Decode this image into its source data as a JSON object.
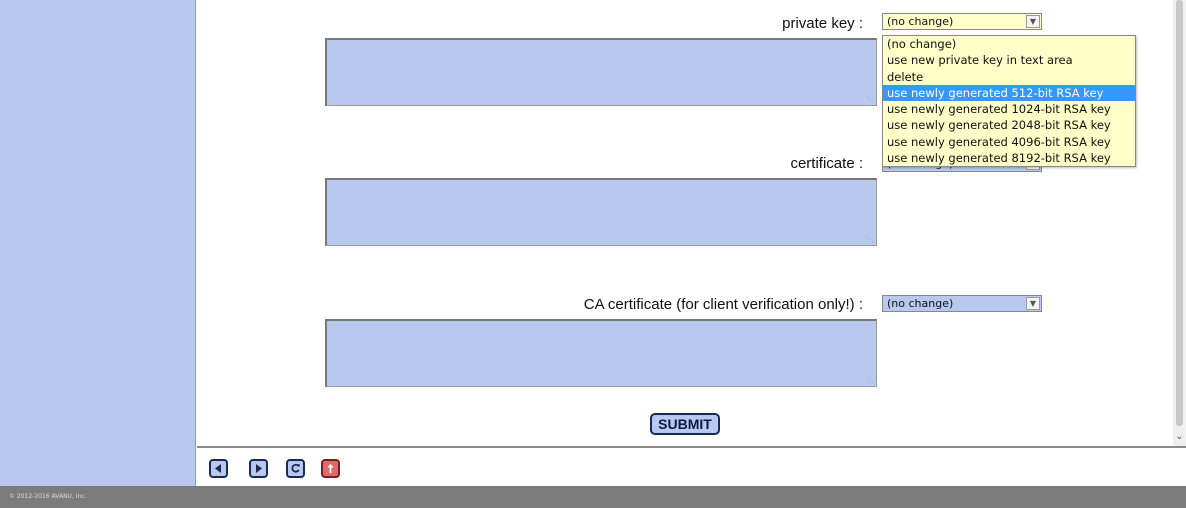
{
  "form": {
    "private_key": {
      "label": "private key :",
      "selected": "(no change)",
      "options": [
        "(no change)",
        "use new private key in text area",
        "delete",
        "use newly generated 512-bit RSA key",
        "use newly generated 1024-bit RSA key",
        "use newly generated 2048-bit RSA key",
        "use newly generated 4096-bit RSA key",
        "use newly generated 8192-bit RSA key"
      ],
      "highlighted_option": "use newly generated 512-bit RSA key"
    },
    "certificate": {
      "label": "certificate :",
      "selected": "(no change)"
    },
    "ca_certificate": {
      "label": "CA certificate (for client verification only!) :",
      "selected": "(no change)"
    },
    "submit_label": "SUBMIT"
  },
  "nav": {
    "icons": [
      "back-icon",
      "forward-icon",
      "refresh-icon",
      "upload-icon"
    ]
  },
  "footer": {
    "copyright": "© 2012-2016 AVANU, Inc."
  },
  "colors": {
    "accent_blue": "#b7c9ee",
    "dropdown_bg": "#fffdc8",
    "highlight": "#3399ff",
    "footer_bg": "#7b7b7b"
  }
}
